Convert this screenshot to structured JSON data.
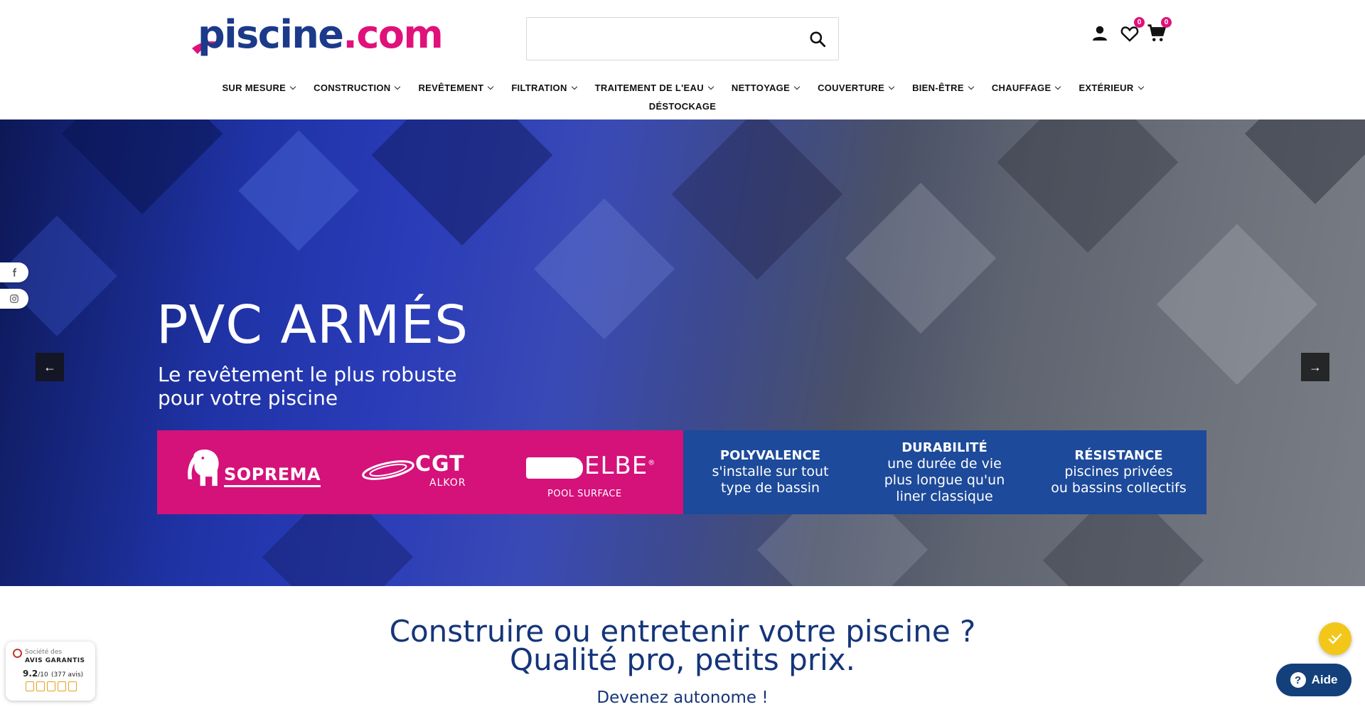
{
  "header": {
    "logo_text_main": "piscine",
    "logo_text_tld": ".com",
    "search": {
      "placeholder": "",
      "value": ""
    },
    "wishlist_count": "0",
    "cart_count": "0",
    "icons": {
      "search": "search-icon",
      "account": "user-icon",
      "wishlist": "heart-icon",
      "cart": "cart-icon"
    }
  },
  "nav": {
    "items": [
      {
        "label": "SUR MESURE"
      },
      {
        "label": "CONSTRUCTION"
      },
      {
        "label": "REVÊTEMENT"
      },
      {
        "label": "FILTRATION"
      },
      {
        "label": "TRAITEMENT DE L'EAU"
      },
      {
        "label": "NETTOYAGE"
      },
      {
        "label": "COUVERTURE"
      },
      {
        "label": "BIEN-ÊTRE"
      },
      {
        "label": "CHAUFFAGE"
      },
      {
        "label": "EXTÉRIEUR"
      }
    ],
    "extra": {
      "label": "DÉSTOCKAGE"
    }
  },
  "hero": {
    "title": "PVC ARMÉS",
    "subtitle_line1": "Le revêtement le plus robuste",
    "subtitle_line2": "pour votre piscine",
    "brands": {
      "soprema": "SOPREMA",
      "cgt": "CGT",
      "cgt_sub": "ALKOR",
      "elbe": "ELBE",
      "elbe_mark": "®",
      "elbe_sub": "POOL SURFACE"
    },
    "features": [
      {
        "title": "POLYVALENCE",
        "line1": "s'installe sur tout",
        "line2": "type de bassin",
        "line3": ""
      },
      {
        "title": "DURABILITÉ",
        "line1": "une durée de vie",
        "line2": "plus longue qu'un",
        "line3": "liner classique"
      },
      {
        "title": "RÉSISTANCE",
        "line1": "piscines privées",
        "line2": "ou bassins collectifs",
        "line3": ""
      }
    ],
    "prev_arrow": "←",
    "next_arrow": "→",
    "colors": {
      "pink": "#d5117a",
      "blue": "#1d4a9a"
    }
  },
  "social": {
    "facebook": "facebook-icon",
    "instagram": "instagram-icon"
  },
  "content": {
    "tagline_line1": "Construire ou entretenir votre piscine ?",
    "tagline_line2": "Qualité pro, petits prix.",
    "tagline_sub": "Devenez autonome !"
  },
  "avis": {
    "line1": "Société des",
    "line2": "AVIS GARANTIS",
    "score": "9.2",
    "scale": "/10",
    "count": "(377 avis)",
    "rating_fraction": 0.92
  },
  "help": {
    "label": "Aide",
    "q": "?"
  },
  "colors": {
    "brand_blue": "#1b3a8a",
    "brand_pink": "#e0117a",
    "headline_blue": "#15357a"
  }
}
